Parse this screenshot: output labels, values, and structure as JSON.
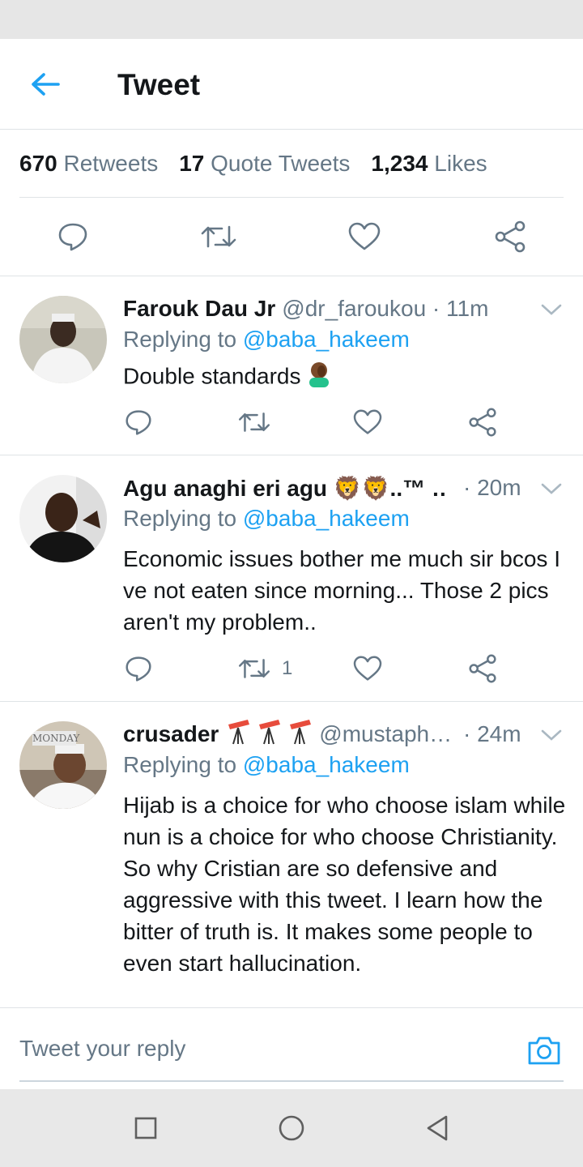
{
  "header": {
    "title": "Tweet",
    "back_icon": "arrow-left-icon"
  },
  "stats": [
    {
      "count": "670",
      "label": "Retweets"
    },
    {
      "count": "17",
      "label": "Quote Tweets"
    },
    {
      "count": "1,234",
      "label": "Likes"
    }
  ],
  "main_actions": [
    "reply-icon",
    "retweet-icon",
    "like-icon",
    "share-icon"
  ],
  "replies": [
    {
      "name": "Farouk Dau Jr",
      "handle": "@dr_faroukou",
      "time": "· 11m",
      "replying_prefix": "Replying to",
      "replying_to": "@baba_hakeem",
      "text": "Double standards",
      "retweet_count": ""
    },
    {
      "name": "Agu anaghi eri agu 🦁🦁..™ …",
      "handle": "",
      "time": "· 20m",
      "replying_prefix": "Replying to",
      "replying_to": "@baba_hakeem",
      "text": "Economic issues bother me much sir bcos I ve not eaten since morning... Those 2 pics aren't my problem..",
      "retweet_count": "1"
    },
    {
      "name": "crusader",
      "handle": "@mustaph…",
      "time": "· 24m",
      "replying_prefix": "Replying to",
      "replying_to": "@baba_hakeem",
      "text": "Hijab is a choice for who choose islam while nun is a choice for who choose Christianity. So why Cristian are so defensive and aggressive with this tweet. I learn how the bitter of truth is. It makes some people to even start hallucination.",
      "avatar_tag": "MONDAY",
      "retweet_count": ""
    }
  ],
  "compose": {
    "placeholder": "Tweet your reply",
    "camera_icon": "camera-icon"
  },
  "nav": [
    "recents-square-icon",
    "home-circle-icon",
    "back-triangle-icon"
  ],
  "colors": {
    "accent": "#1da1f2",
    "text": "#14171a",
    "muted": "#657786",
    "divider": "#dfe3e6"
  }
}
